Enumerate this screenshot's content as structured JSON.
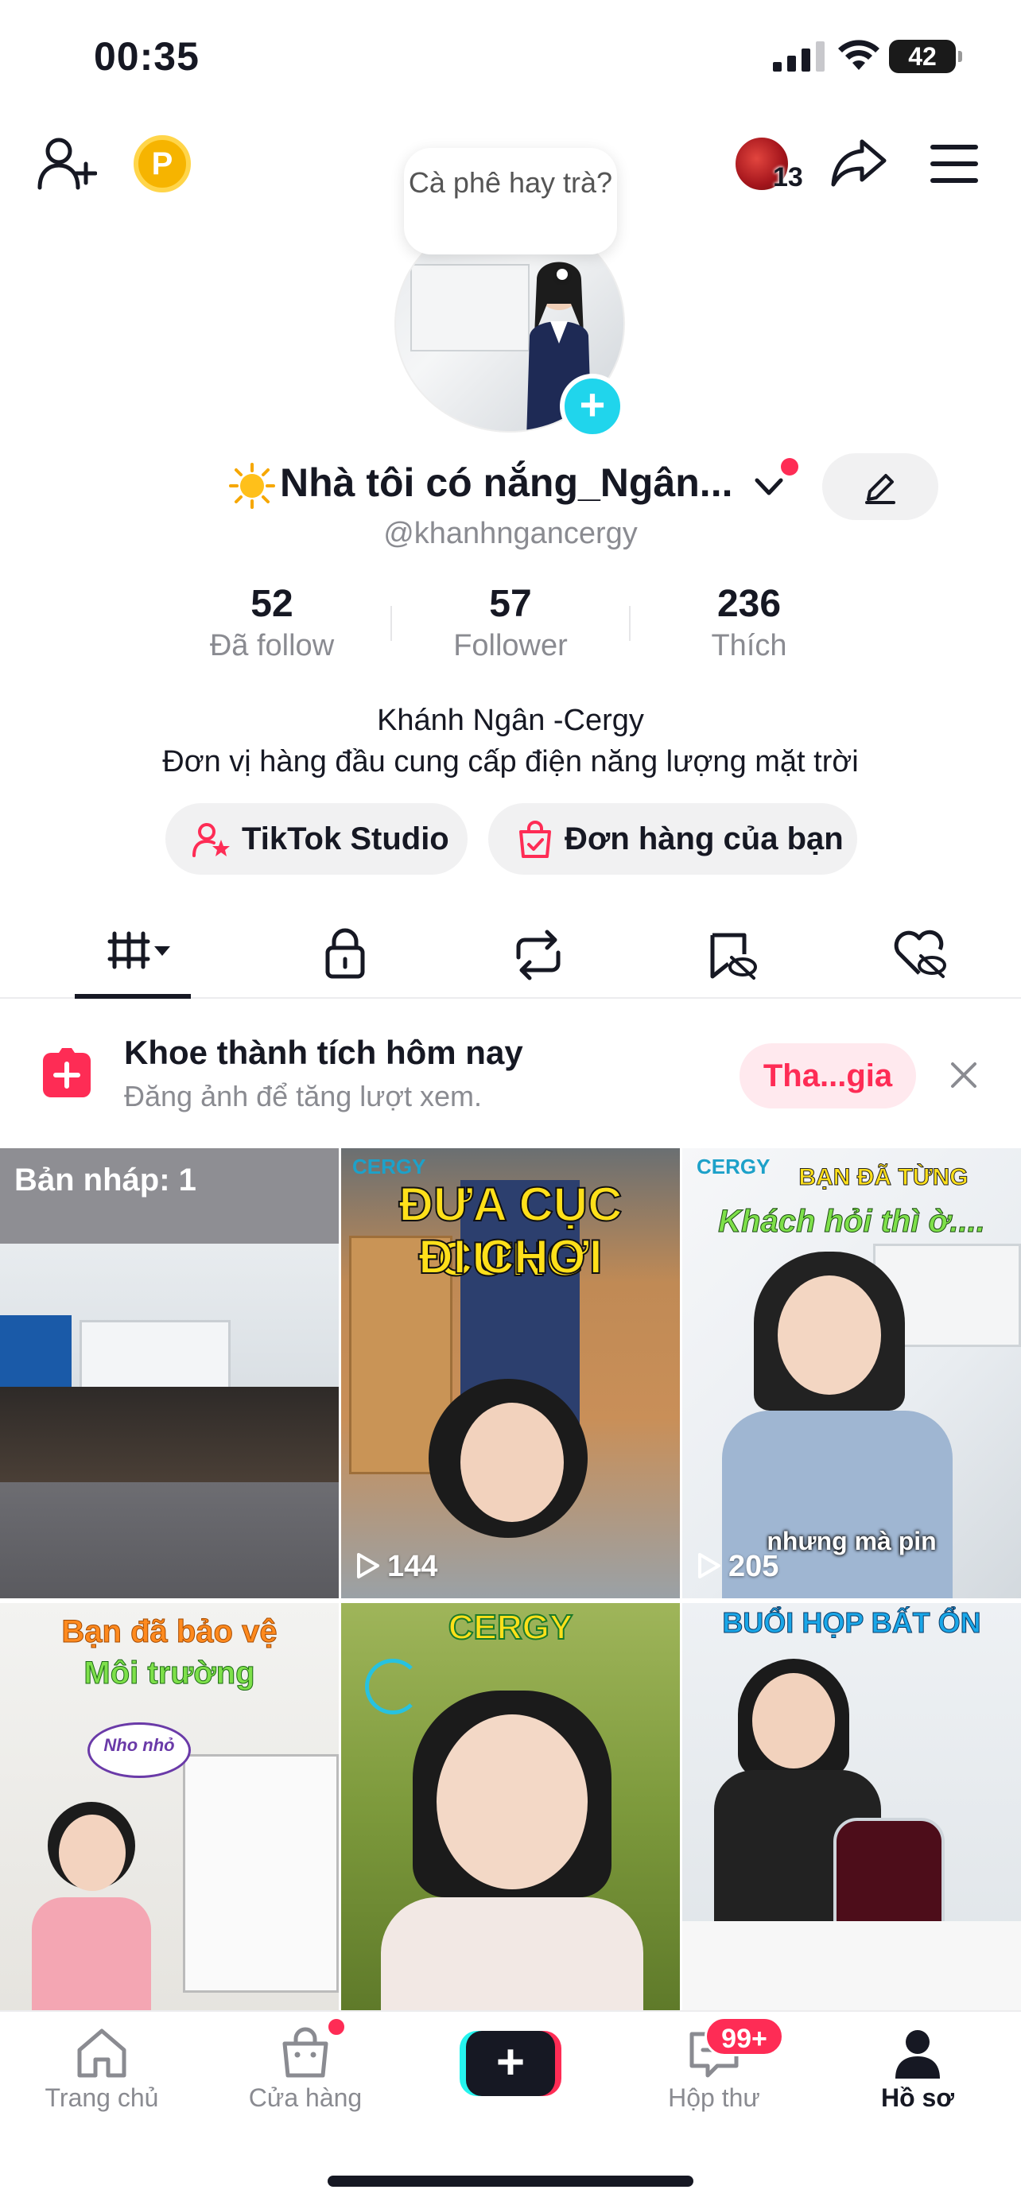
{
  "status_bar": {
    "time": "00:35",
    "battery": "42"
  },
  "top_bar": {
    "coin_label": "P",
    "visitor_count": "13"
  },
  "profile": {
    "note_bubble": "Cà phê hay trà?",
    "nickname": "Nhà tôi có nắng_Ngân...",
    "username": "@khanhngancergy",
    "bio_line1": "Khánh Ngân -Cergy",
    "bio_line2": "Đơn vị hàng đầu cung cấp điện năng lượng mặt trời"
  },
  "stats": [
    {
      "value": "52",
      "label": "Đã follow"
    },
    {
      "value": "57",
      "label": "Follower"
    },
    {
      "value": "236",
      "label": "Thích"
    }
  ],
  "actions": {
    "studio": "TikTok Studio",
    "orders": "Đơn hàng của bạn"
  },
  "promo": {
    "title": "Khoe thành tích hôm nay",
    "subtitle": "Đăng ảnh để tăng lượt xem.",
    "button": "Tha...gia"
  },
  "grid": {
    "draft_label": "Bản nháp: 1",
    "video1_text1": "CERGY",
    "video1_text2": "ĐƯA CỤC CƯNG",
    "video1_text3": "ĐI CHƠI",
    "video1_views": "144",
    "video2_text1": "CERGY",
    "video2_text2": "BẠN ĐÃ TỪNG",
    "video2_text3": "Khách hỏi thì ờ....",
    "video2_caption": "nhưng mà pin",
    "video2_views": "205",
    "video3_text1": "Bạn đã bảo vệ",
    "video3_text2": "Môi trường",
    "video3_bubble": "Nho nhỏ",
    "video4_text1": "CERGY",
    "video5_text1": "BUỔI HỌP BẤT ỔN"
  },
  "bottom_nav": {
    "home": "Trang chủ",
    "shop": "Cửa hàng",
    "inbox": "Hộp thư",
    "inbox_badge": "99+",
    "profile": "Hồ sơ"
  },
  "colors": {
    "brand_red": "#fe2c55",
    "brand_cyan": "#25f4ee",
    "text_dark": "#161823",
    "text_gray": "#8a8b91"
  }
}
